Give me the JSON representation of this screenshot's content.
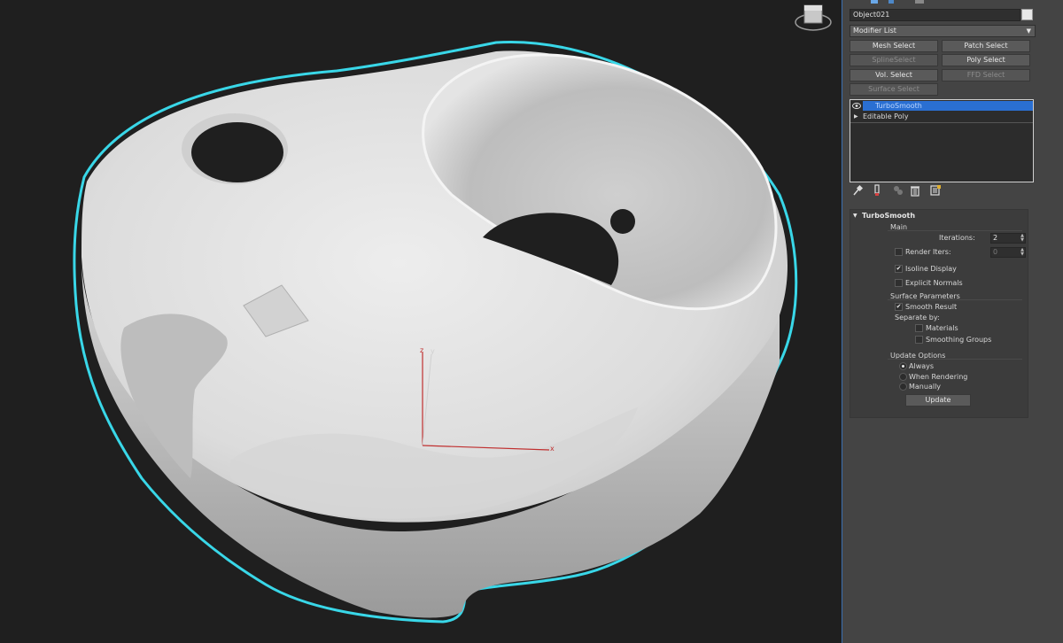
{
  "object": {
    "name": "Object021",
    "color": "#e8e8e8"
  },
  "modifier_list": {
    "label": "Modifier List"
  },
  "modifier_buttons": [
    {
      "label": "Mesh Select",
      "enabled": true
    },
    {
      "label": "Patch Select",
      "enabled": true
    },
    {
      "label": "SplineSelect",
      "enabled": false
    },
    {
      "label": "Poly Select",
      "enabled": true
    },
    {
      "label": "Vol. Select",
      "enabled": true
    },
    {
      "label": "FFD Select",
      "enabled": false
    },
    {
      "label": "Surface Select",
      "enabled": false
    }
  ],
  "stack": {
    "items": [
      {
        "label": "TurboSmooth",
        "selected": true
      },
      {
        "label": "Editable Poly",
        "selected": false
      }
    ]
  },
  "stack_tools": [
    "pin-stack-icon",
    "show-end-result-icon",
    "make-unique-icon",
    "remove-modifier-icon",
    "configure-modifier-sets-icon"
  ],
  "turbosmooth": {
    "title": "TurboSmooth",
    "main_label": "Main",
    "iterations_label": "Iterations:",
    "iterations_value": "2",
    "render_iters_label": "Render Iters:",
    "render_iters_value": "0",
    "render_iters_checked": false,
    "isoline_label": "Isoline Display",
    "isoline_checked": true,
    "explicit_normals_label": "Explicit Normals",
    "explicit_normals_checked": false,
    "surface_params_label": "Surface Parameters",
    "smooth_result_label": "Smooth Result",
    "smooth_result_checked": true,
    "separate_by_label": "Separate by:",
    "materials_label": "Materials",
    "materials_checked": false,
    "smoothing_groups_label": "Smoothing Groups",
    "smoothing_groups_checked": false,
    "update_options_label": "Update Options",
    "update_always_label": "Always",
    "update_rendering_label": "When Rendering",
    "update_manually_label": "Manually",
    "update_selected": "Always",
    "update_button_label": "Update"
  },
  "viewport": {
    "axis_labels": {
      "x": "x",
      "y": "y",
      "z": "z"
    },
    "selection_outline_color": "#39d7e8",
    "axis_colors": {
      "x": "#c03030",
      "y": "#d0d0d0",
      "z": "#c03030"
    },
    "viewcube_label": "viewcube-icon"
  },
  "colors": {
    "panel_bg": "#444444",
    "accent": "#2a6fd2",
    "viewport_bg": "#1f1f1f"
  }
}
